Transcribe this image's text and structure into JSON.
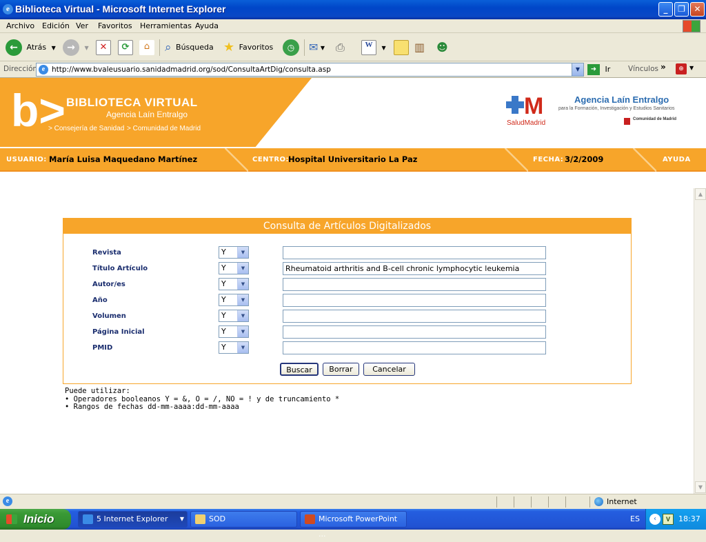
{
  "window": {
    "title": "Biblioteca Virtual - Microsoft Internet Explorer"
  },
  "menu": [
    "Archivo",
    "Edición",
    "Ver",
    "Favoritos",
    "Herramientas",
    "Ayuda"
  ],
  "toolbar": {
    "back": "Atrás",
    "search": "Búsqueda",
    "favorites": "Favoritos"
  },
  "address": {
    "label": "Dirección",
    "url": "http://www.bvaleusuario.sanidadmadrid.org/sod/ConsultaArtDig/consulta.asp",
    "go": "Ir",
    "links": "Vínculos"
  },
  "banner": {
    "title": "BIBLIOTECA VIRTUAL",
    "subtitle": "Agencia Laín Entralgo",
    "link1": "> Consejería de Sanidad",
    "link2": "> Comunidad de Madrid",
    "agency_name": "Agencia Laín Entralgo",
    "agency_desc": "para la Formación, Investigación y Estudios Sanitarios",
    "salud": "SaludMadrid",
    "comunidad": "Comunidad de Madrid"
  },
  "userbar": {
    "user_label": "USUARIO:",
    "user_value": "María Luisa  Maquedano Martínez",
    "center_label": "CENTRO:",
    "center_value": "Hospital Universitario La Paz",
    "date_label": "FECHA:",
    "date_value": "3/2/2009",
    "help": "AYUDA"
  },
  "form": {
    "title": "Consulta de Artículos Digitalizados",
    "fields": [
      {
        "label": "Revista",
        "op": "Y",
        "value": ""
      },
      {
        "label": "Título Artículo",
        "op": "Y",
        "value": "Rheumatoid arthritis and B-cell chronic lymphocytic leukemia"
      },
      {
        "label": "Autor/es",
        "op": "Y",
        "value": ""
      },
      {
        "label": "Año",
        "op": "Y",
        "value": ""
      },
      {
        "label": "Volumen",
        "op": "Y",
        "value": ""
      },
      {
        "label": "Página Inicial",
        "op": "Y",
        "value": ""
      },
      {
        "label": "PMID",
        "op": "Y",
        "value": ""
      }
    ],
    "buttons": {
      "search": "Buscar",
      "clear": "Borrar",
      "cancel": "Cancelar"
    }
  },
  "help": {
    "line1": "Puede utilizar:",
    "line2": "• Operadores booleanos Y = &, O = /, NO = ! y de truncamiento *",
    "line3": "• Rangos de fechas dd-mm-aaaa:dd-mm-aaaa"
  },
  "status": {
    "zone": "Internet"
  },
  "taskbar": {
    "start": "Inicio",
    "tasks": [
      "5 Internet Explorer",
      "SOD",
      "Microsoft PowerPoint ..."
    ],
    "lang": "ES",
    "time": "18:37"
  },
  "colors": {
    "accent": "#f7a52a",
    "label_navy": "#1a2d6e",
    "xp_blue": "#0a5fd8"
  }
}
